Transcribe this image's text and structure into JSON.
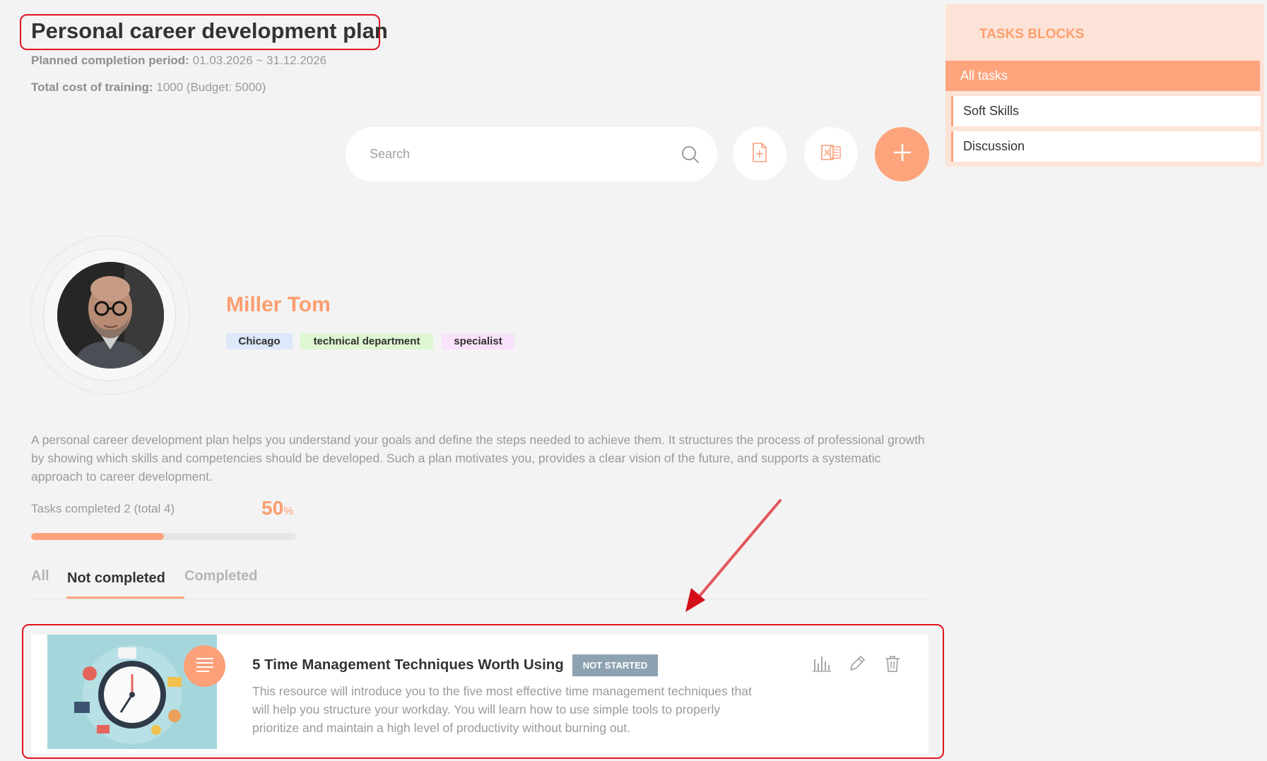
{
  "header": {
    "title": "Personal career development plan",
    "period_label": "Planned completion period:",
    "period_value": "01.03.2026 ~ 31.12.2026",
    "cost_label": "Total cost of training:",
    "cost_value": "1000 (Budget: 5000)"
  },
  "toolbar": {
    "search_placeholder": "Search",
    "search_value": "",
    "icons": [
      "search-icon",
      "add-file-icon",
      "excel-icon",
      "plus-icon"
    ]
  },
  "sidebar": {
    "title": "TASKS BLOCKS",
    "items": [
      {
        "label": "All tasks",
        "active": true
      },
      {
        "label": "Soft Skills",
        "active": false
      },
      {
        "label": "Discussion",
        "active": false
      }
    ]
  },
  "profile": {
    "name": "Miller Tom",
    "tags": {
      "city": "Chicago",
      "department": "technical department",
      "role": "specialist"
    }
  },
  "description": "A personal career development plan helps you understand your goals and define the steps needed to achieve them. It structures the process of professional growth by showing which skills and competencies should be developed. Such a plan motivates you, provides a clear vision of the future, and supports a systematic approach to career development.",
  "progress": {
    "label": "Tasks completed 2 (total 4)",
    "value": "50",
    "unit": "%",
    "fraction": 0.5
  },
  "tabs": [
    {
      "label": "All",
      "active": false
    },
    {
      "label": "Not completed",
      "active": true
    },
    {
      "label": "Completed",
      "active": false
    }
  ],
  "tasks": [
    {
      "title": "5 Time Management Techniques Worth Using",
      "status": "NOT STARTED",
      "description": "This resource will introduce you to the five most effective time management techniques that will help you structure your workday. You will learn how to use simple tools to properly prioritize and maintain a high level of productivity without burning out."
    }
  ],
  "colors": {
    "accent": "#fda47c",
    "accent_text": "#fc9e6f",
    "sidebar_bg": "#fde3d7",
    "highlight": "#e0141e",
    "status_badge": "#8ea3b2"
  }
}
